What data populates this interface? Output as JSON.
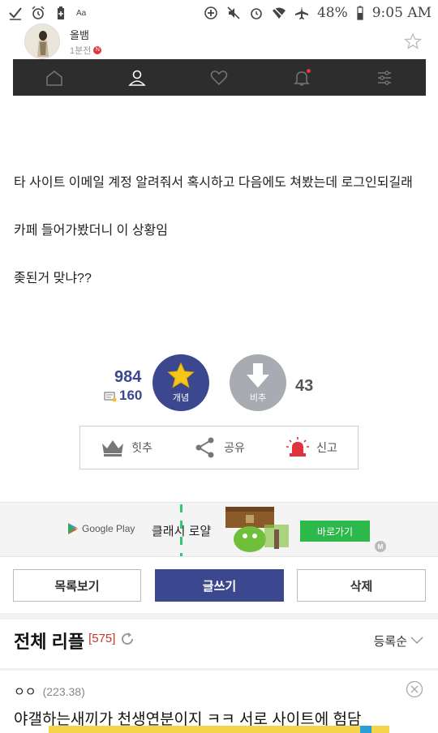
{
  "status_bar": {
    "battery": "48%",
    "time": "9:05 AM",
    "small_label": "Aa"
  },
  "author": {
    "name": "올뱀",
    "time": "1분전",
    "new_badge": "N"
  },
  "post": {
    "paragraphs": [
      "타 사이트 이메일 계정 알려줘서 혹시하고 다음에도 쳐봤는데 로그인되길래",
      "카페 들어가봤더니 이 상황임",
      "좆된거 맞냐??"
    ]
  },
  "votes": {
    "up_count": "984",
    "comment_count": "160",
    "up_label": "개념",
    "down_label": "비추",
    "down_count": "43"
  },
  "actions": {
    "hit": "힛추",
    "share": "공유",
    "report": "신고"
  },
  "ad": {
    "store": "Google Play",
    "title": "클래시 로얄",
    "button": "바로가기",
    "mark": "M"
  },
  "buttons": {
    "list": "목록보기",
    "write": "글쓰기",
    "delete": "삭제"
  },
  "replies": {
    "title": "전체 리플",
    "count": "[575]",
    "sort": "등록순"
  },
  "comment": {
    "author": "ㅇㅇ",
    "ip": "(223.38)",
    "text": "야갤하는새끼가 천생연분이지 ㅋㅋ 서로 사이트에 험담"
  },
  "colors": {
    "accent": "#3b4890",
    "navbar": "#2d2d2d",
    "ad_button": "#2db84b",
    "reply_count": "#c0392b"
  }
}
